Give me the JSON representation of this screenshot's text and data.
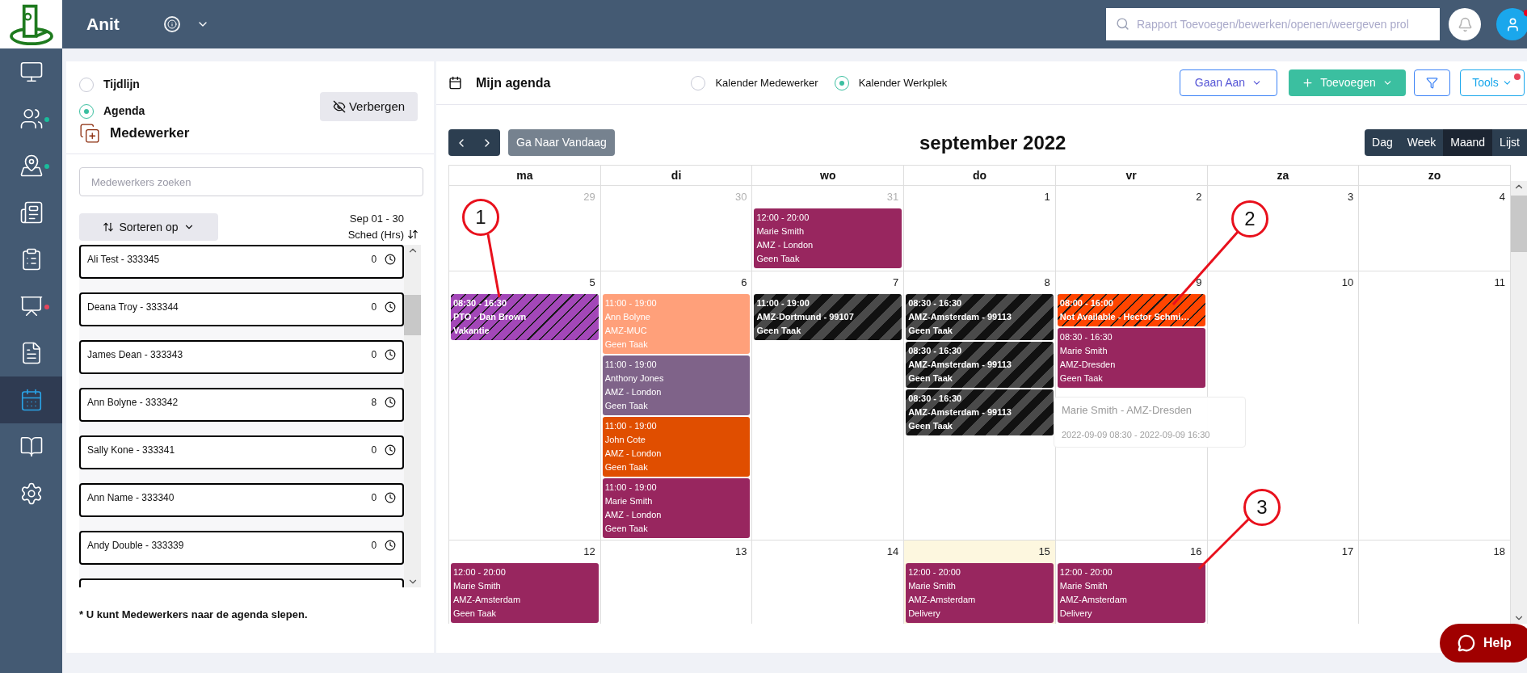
{
  "topbar": {
    "app_name": "Anit",
    "search": {
      "placeholder": "Rapport Toevoegen/bewerken/openen/weergeven prol"
    },
    "notifications_badge": false,
    "profile_badge": true
  },
  "sidebar": {
    "items": [
      {
        "kind": "monitor",
        "selected": false
      },
      {
        "kind": "users",
        "selected": false,
        "color": "#1abc9c"
      },
      {
        "kind": "map",
        "selected": false,
        "color": "#1abc9c"
      },
      {
        "kind": "board",
        "selected": false
      },
      {
        "kind": "clipboard",
        "selected": false
      },
      {
        "kind": "presentation",
        "selected": false,
        "color": "#e8455b"
      },
      {
        "kind": "document",
        "selected": false
      },
      {
        "kind": "calendar",
        "selected": true
      },
      {
        "kind": "book",
        "selected": false
      },
      {
        "kind": "settings",
        "selected": false
      }
    ]
  },
  "left_panel": {
    "view_options": [
      {
        "label": "Tijdlijn",
        "selected": false
      },
      {
        "label": "Agenda",
        "selected": true
      }
    ],
    "hide_button": "Verbergen",
    "title": "Medewerker",
    "search": {
      "placeholder": "Medewerkers zoeken"
    },
    "sort_button": "Sorteren op",
    "range": "Sep 01 - 30",
    "hours_heading": "Sched (Hrs)",
    "employees": [
      {
        "name": "Ali Test - 333345",
        "hours": "0"
      },
      {
        "name": "Deana Troy - 333344",
        "hours": "0"
      },
      {
        "name": "James Dean - 333343",
        "hours": "0"
      },
      {
        "name": "Ann Bolyne - 333342",
        "hours": "8"
      },
      {
        "name": "Sally Kone - 333341",
        "hours": "0"
      },
      {
        "name": "Ann Name - 333340",
        "hours": "0"
      },
      {
        "name": "Andy Double - 333339",
        "hours": "0"
      }
    ],
    "note": "* U kunt Medewerkers naar de agenda slepen."
  },
  "calendar": {
    "title": "Mijn agenda",
    "calendar_options": [
      {
        "label": "Kalender Medewerker",
        "selected": false
      },
      {
        "label": "Kalender Werkplek",
        "selected": true
      }
    ],
    "goto_button": "Gaan Aan",
    "add_button": "Toevoegen",
    "tools_button": "Tools",
    "tools_badge": true,
    "today_button": "Ga Naar Vandaag",
    "month": "september 2022",
    "views": [
      {
        "label": "Dag",
        "selected": false
      },
      {
        "label": "Week",
        "selected": false
      },
      {
        "label": "Maand",
        "selected": true
      },
      {
        "label": "Lijst",
        "selected": false
      }
    ],
    "weekdays": [
      "ma",
      "di",
      "wo",
      "do",
      "vr",
      "za",
      "zo"
    ],
    "weeks": [
      {
        "days": [
          {
            "date": "29",
            "muted": true,
            "today": false
          },
          {
            "date": "30",
            "muted": true,
            "today": false
          },
          {
            "date": "31",
            "muted": true,
            "today": false,
            "events": [
              {
                "lines": [
                  "12:00 - 20:00",
                  "Marie Smith",
                  "AMZ - London",
                  "Geen Taak"
                ],
                "color": "#98265f",
                "kind": "plain",
                "bold": false
              }
            ]
          },
          {
            "date": "1",
            "muted": false,
            "today": false
          },
          {
            "date": "2",
            "muted": false,
            "today": false
          },
          {
            "date": "3",
            "muted": false,
            "today": false
          },
          {
            "date": "4",
            "muted": false,
            "today": false
          }
        ]
      },
      {
        "days": [
          {
            "date": "5",
            "muted": false,
            "today": false,
            "events": [
              {
                "lines": [
                  "08:30 - 16:30",
                  "PTO - Dan Brown",
                  "Vakantie"
                ],
                "color": "#a347b8",
                "kind": "hatched",
                "bold": true
              }
            ]
          },
          {
            "date": "6",
            "muted": false,
            "today": false,
            "events": [
              {
                "lines": [
                  "11:00 - 19:00",
                  "Ann Bolyne",
                  "AMZ-MUC",
                  "Geen Taak"
                ],
                "color": "#ffa07a",
                "kind": "plain",
                "bold": false
              },
              {
                "lines": [
                  "11:00 - 19:00",
                  "Anthony Jones",
                  "AMZ - London",
                  "Geen Taak"
                ],
                "color": "#7f6389",
                "kind": "plain",
                "bold": false
              },
              {
                "lines": [
                  "11:00 - 19:00",
                  "John Cote",
                  "AMZ - London",
                  "Geen Taak"
                ],
                "color": "#e04e00",
                "kind": "plain",
                "bold": false
              },
              {
                "lines": [
                  "11:00 - 19:00",
                  "Marie Smith",
                  "AMZ - London",
                  "Geen Taak"
                ],
                "color": "#98265f",
                "kind": "plain",
                "bold": false
              }
            ]
          },
          {
            "date": "7",
            "muted": false,
            "today": false,
            "events": [
              {
                "lines": [
                  "11:00 - 19:00",
                  "AMZ-Dortmund - 99107",
                  "Geen Taak"
                ],
                "color": "#111111",
                "kind": "banded",
                "bold": true
              }
            ]
          },
          {
            "date": "8",
            "muted": false,
            "today": false,
            "events": [
              {
                "lines": [
                  "08:30 - 16:30",
                  "AMZ-Amsterdam - 99113",
                  "Geen Taak"
                ],
                "color": "#111111",
                "kind": "banded",
                "bold": true
              },
              {
                "lines": [
                  "08:30 - 16:30",
                  "AMZ-Amsterdam - 99113",
                  "Geen Taak"
                ],
                "color": "#111111",
                "kind": "banded",
                "bold": true
              },
              {
                "lines": [
                  "08:30 - 16:30",
                  "AMZ-Amsterdam - 99113",
                  "Geen Taak"
                ],
                "color": "#111111",
                "kind": "banded",
                "bold": true
              }
            ]
          },
          {
            "date": "9",
            "muted": false,
            "today": false,
            "events": [
              {
                "lines": [
                  "08:00 - 16:00",
                  "Not Available - Hector Schmi…"
                ],
                "color": "#ff4500",
                "kind": "hatched",
                "bold": true
              },
              {
                "lines": [
                  "08:30 - 16:30",
                  "Marie Smith",
                  "AMZ-Dresden",
                  "Geen Taak"
                ],
                "color": "#98265f",
                "kind": "plain",
                "bold": false
              }
            ]
          },
          {
            "date": "10",
            "muted": false,
            "today": false
          },
          {
            "date": "11",
            "muted": false,
            "today": false
          }
        ]
      },
      {
        "days": [
          {
            "date": "12",
            "muted": false,
            "today": false,
            "events": [
              {
                "lines": [
                  "12:00 - 20:00",
                  "Marie Smith",
                  "AMZ-Amsterdam",
                  "Geen Taak"
                ],
                "color": "#98265f",
                "kind": "plain",
                "bold": false
              }
            ]
          },
          {
            "date": "13",
            "muted": false,
            "today": false
          },
          {
            "date": "14",
            "muted": false,
            "today": false
          },
          {
            "date": "15",
            "muted": false,
            "today": true,
            "events": [
              {
                "lines": [
                  "12:00 - 20:00",
                  "Marie Smith",
                  "AMZ-Amsterdam",
                  "Delivery"
                ],
                "color": "#98265f",
                "kind": "plain",
                "bold": false
              }
            ]
          },
          {
            "date": "16",
            "muted": false,
            "today": false,
            "events": [
              {
                "lines": [
                  "12:00 - 20:00",
                  "Marie Smith",
                  "AMZ-Amsterdam",
                  "Delivery"
                ],
                "color": "#98265f",
                "kind": "plain",
                "bold": false
              }
            ]
          },
          {
            "date": "17",
            "muted": false,
            "today": false
          },
          {
            "date": "18",
            "muted": false,
            "today": false
          }
        ]
      }
    ],
    "tooltip": {
      "title": "Marie Smith - AMZ-Dresden",
      "subtitle": "2022-09-09 08:30 - 2022-09-09 16:30"
    }
  },
  "help_button": "Help",
  "annotations": [
    {
      "label": "1"
    },
    {
      "label": "2"
    },
    {
      "label": "3"
    }
  ]
}
